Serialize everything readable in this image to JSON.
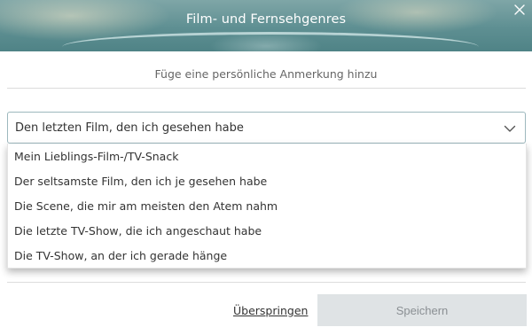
{
  "header": {
    "title": "Film- und Fernsehgenres",
    "close_icon": "close-icon"
  },
  "subtitle": "Füge eine persönliche Anmerkung hinzu",
  "select": {
    "value": "Den letzten Film, den ich gesehen habe",
    "chevron_icon": "chevron-down-icon",
    "options": [
      "Mein Lieblings-Film-/TV-Snack",
      "Der seltsamste Film, den ich je gesehen habe",
      "Die Scene, die mir am meisten den Atem nahm",
      "Die letzte TV-Show, die ich angeschaut habe",
      "Die TV-Show, an der ich gerade hänge"
    ]
  },
  "footer": {
    "skip_label": "Überspringen",
    "save_label": "Speichern"
  },
  "colors": {
    "header_teal": "#5e8f92",
    "save_disabled_bg": "#dfe3e5",
    "select_border": "#9db8be"
  }
}
